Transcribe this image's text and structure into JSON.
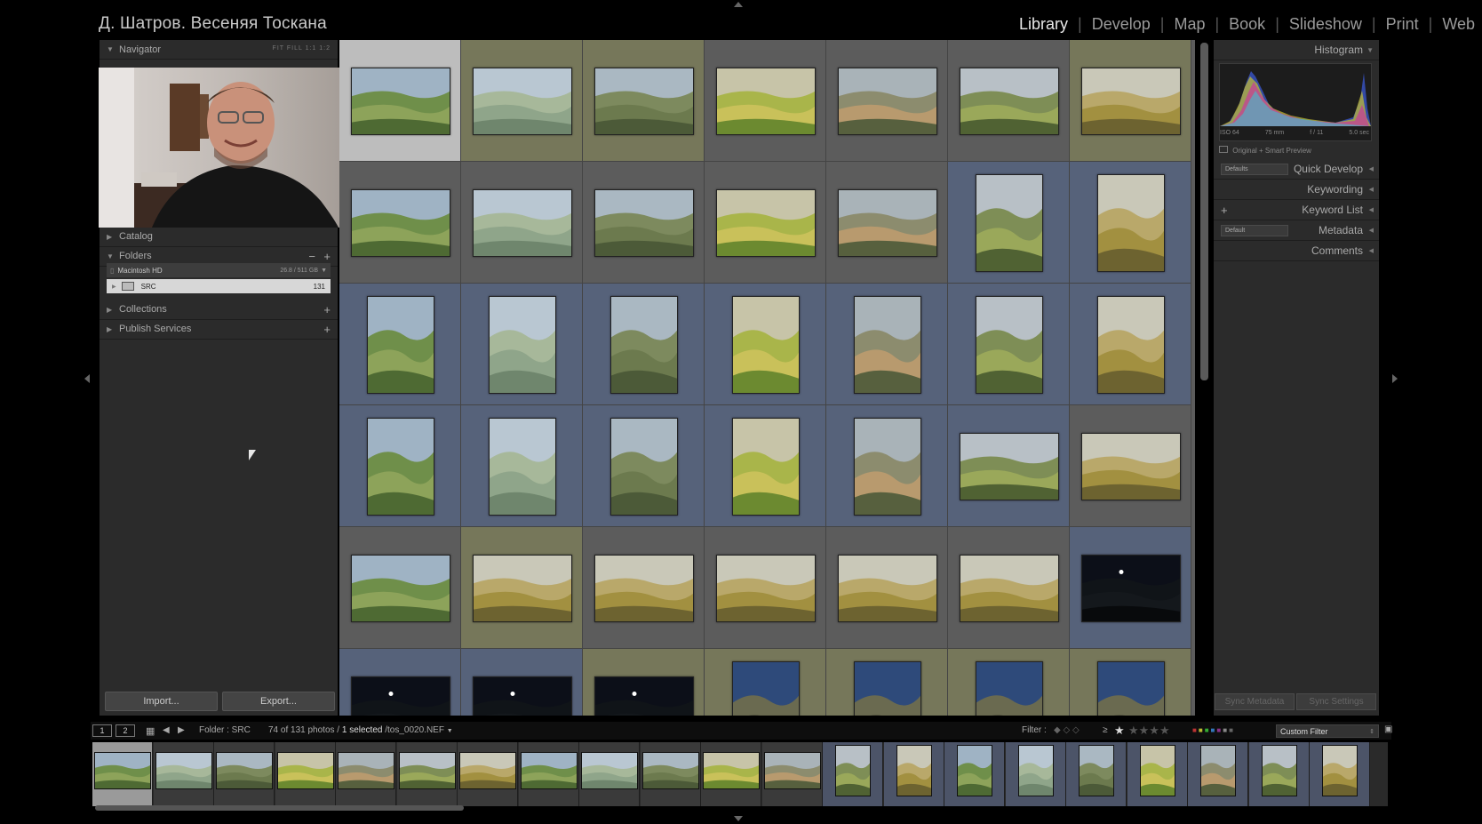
{
  "identity_plate": "Д. Шатров. Весеняя Тоскана",
  "modules": [
    {
      "label": "Library",
      "active": true
    },
    {
      "label": "Develop",
      "active": false
    },
    {
      "label": "Map",
      "active": false
    },
    {
      "label": "Book",
      "active": false
    },
    {
      "label": "Slideshow",
      "active": false
    },
    {
      "label": "Print",
      "active": false
    },
    {
      "label": "Web",
      "active": false
    }
  ],
  "left_panel": {
    "navigator": {
      "title": "Navigator",
      "zoom_options": [
        "FIT",
        "FILL",
        "1:1",
        "1:2"
      ]
    },
    "catalog": {
      "title": "Catalog"
    },
    "folders": {
      "title": "Folders",
      "volume": {
        "name": "Macintosh HD",
        "space": "26.8 / 511 GB"
      },
      "items": [
        {
          "name": "SRC",
          "count": "131"
        }
      ]
    },
    "collections": {
      "title": "Collections"
    },
    "publish_services": {
      "title": "Publish Services"
    },
    "import_label": "Import...",
    "export_label": "Export..."
  },
  "right_panel": {
    "histogram": {
      "title": "Histogram",
      "iso": "ISO 64",
      "focal": "75 mm",
      "aperture": "f / 11",
      "shutter": "5.0 sec"
    },
    "preview_status": "Original + Smart Preview",
    "quick_develop": {
      "title": "Quick Develop",
      "preset": "Defaults"
    },
    "keywording": {
      "title": "Keywording"
    },
    "keyword_list": {
      "title": "Keyword List"
    },
    "metadata": {
      "title": "Metadata",
      "preset": "Default"
    },
    "comments": {
      "title": "Comments"
    },
    "sync_metadata_label": "Sync Metadata",
    "sync_settings_label": "Sync Settings"
  },
  "toolbar": {
    "page1": "1",
    "page2": "2",
    "source": "Folder : SRC",
    "count": "74 of 131 photos /",
    "selected": "1 selected",
    "filename": "/tos_0020.NEF",
    "filter_label": "Filter :",
    "rating_op": "≥",
    "custom_filter": "Custom Filter"
  },
  "colors": {
    "grid_gray": "#5c5c5c",
    "label_yellow": "#76775a",
    "label_blue": "#56627a",
    "selected_cell": "#bdbdbd",
    "active_module": "#e8e8e8"
  },
  "thumbnail_rows": [
    [
      "selected",
      "yellow",
      "yellow",
      "gray",
      "gray",
      "gray",
      "yellow"
    ],
    [
      "gray",
      "gray",
      "gray",
      "gray",
      "gray",
      "blue",
      "blue"
    ],
    [
      "blue",
      "blue",
      "blue",
      "blue",
      "blue",
      "blue",
      "blue"
    ],
    [
      "blue",
      "blue",
      "blue",
      "blue",
      "blue",
      "blue",
      "gray"
    ],
    [
      "gray",
      "yellow",
      "gray",
      "gray",
      "gray",
      "gray",
      "blue"
    ],
    [
      "blue",
      "blue",
      "yellow",
      "yellow",
      "yellow",
      "yellow",
      "yellow"
    ]
  ],
  "filmstrip": [
    "selected",
    "gray",
    "gray",
    "gray",
    "gray",
    "gray",
    "gray",
    "gray",
    "gray",
    "gray",
    "gray",
    "gray",
    "blue",
    "blue",
    "blue",
    "blue",
    "blue",
    "blue",
    "blue",
    "blue",
    "blue"
  ]
}
